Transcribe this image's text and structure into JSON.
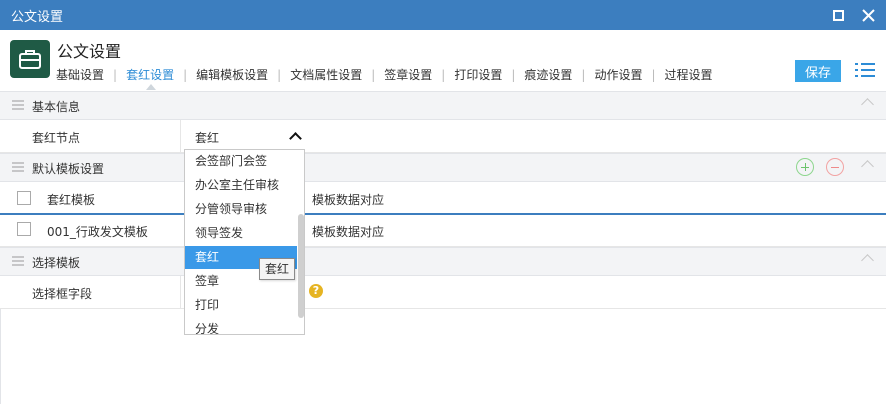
{
  "window": {
    "title": "公文设置"
  },
  "header": {
    "title": "公文设置",
    "save_label": "保存",
    "tabs": [
      {
        "label": "基础设置",
        "active": false
      },
      {
        "label": "套红设置",
        "active": true
      },
      {
        "label": "编辑模板设置",
        "active": false
      },
      {
        "label": "文档属性设置",
        "active": false
      },
      {
        "label": "签章设置",
        "active": false
      },
      {
        "label": "打印设置",
        "active": false
      },
      {
        "label": "痕迹设置",
        "active": false
      },
      {
        "label": "动作设置",
        "active": false
      },
      {
        "label": "过程设置",
        "active": false
      }
    ]
  },
  "sections": {
    "basic": {
      "title": "基本信息",
      "field_label": "套红节点",
      "field_value": "套红"
    },
    "default_template": {
      "title": "默认模板设置",
      "columns": [
        "套红模板",
        "模板数据对应"
      ],
      "rows": [
        {
          "template": "001_行政发文模板",
          "mapping": "模板数据对应"
        }
      ]
    },
    "select_template": {
      "title": "选择模板",
      "field_label": "选择框字段"
    }
  },
  "dropdown": {
    "options": [
      "会签部门会签",
      "办公室主任审核",
      "分管领导审核",
      "领导签发",
      "套红",
      "签章",
      "打印",
      "分发"
    ],
    "selected": "套红",
    "tooltip": "套红"
  },
  "colors": {
    "titlebar": "#3c7ebf",
    "accent": "#2d8cd6",
    "save": "#3aa6e8",
    "selected_option": "#3a99e8"
  }
}
